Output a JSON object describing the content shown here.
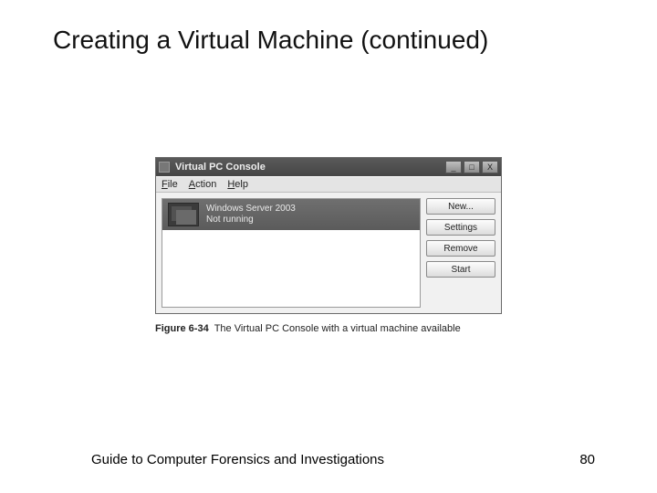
{
  "slide": {
    "title": "Creating a Virtual Machine (continued)",
    "footer_text": "Guide to Computer Forensics and Investigations",
    "page_number": "80"
  },
  "figure": {
    "label": "Figure 6-34",
    "caption": "The Virtual PC Console with a virtual machine available"
  },
  "window": {
    "title": "Virtual PC Console",
    "controls": {
      "min": "_",
      "max": "□",
      "close": "X"
    },
    "menu": {
      "file": "File",
      "action": "Action",
      "help": "Help"
    },
    "vm": {
      "name": "Windows Server 2003",
      "status": "Not running"
    },
    "buttons": {
      "new": "New...",
      "settings": "Settings",
      "remove": "Remove",
      "start": "Start"
    }
  }
}
